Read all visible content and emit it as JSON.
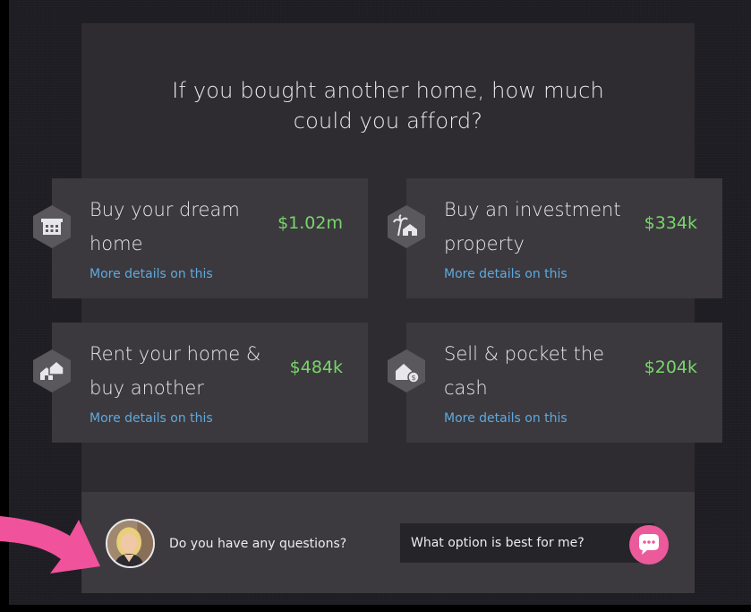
{
  "headline": {
    "line1": "If you bought another home, how much",
    "line2": "could you afford?"
  },
  "options": [
    {
      "title_line1": "Buy your dream",
      "title_line2": "home",
      "value": "$1.02m",
      "link": "More details on this",
      "icon": "building-icon"
    },
    {
      "title_line1": "Buy an investment",
      "title_line2": "property",
      "value": "$334k",
      "link": "More details on this",
      "icon": "palm-house-icon"
    },
    {
      "title_line1": "Rent your home &",
      "title_line2": "buy another",
      "value": "$484k",
      "link": "More details on this",
      "icon": "two-houses-icon"
    },
    {
      "title_line1": "Sell & pocket the",
      "title_line2": "cash",
      "value": "$204k",
      "link": "More details on this",
      "icon": "house-money-icon"
    }
  ],
  "footer": {
    "question": "Do you have any questions?",
    "ask_prompt": "What option is best for me?",
    "chat_icon": "chat-bubble-icon",
    "avatar_icon": "agent-avatar"
  },
  "colors": {
    "accent_green": "#78d66a",
    "link_blue": "#5ea9de",
    "chat_pink": "#ec5a9c",
    "arrow_pink": "#f0529c"
  }
}
